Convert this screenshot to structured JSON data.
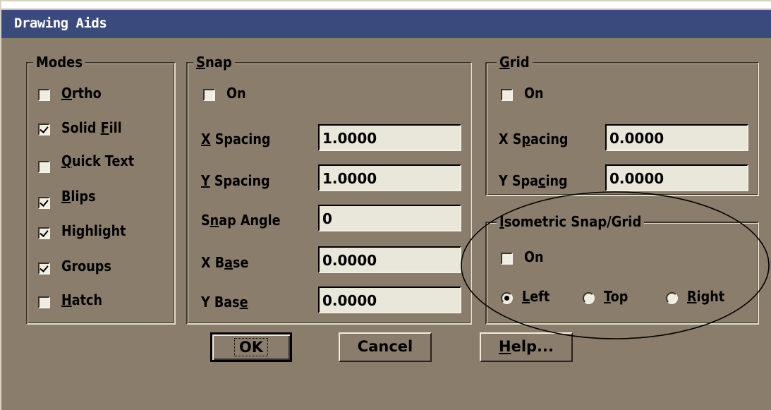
{
  "dialog": {
    "title": "Drawing Aids"
  },
  "modes": {
    "legend": "Modes",
    "items": [
      {
        "pre": "",
        "key": "O",
        "post": "rtho",
        "checked": false
      },
      {
        "pre": "Solid ",
        "key": "F",
        "post": "ill",
        "checked": true
      },
      {
        "pre": "",
        "key": "Q",
        "post": "uick Text",
        "checked": false
      },
      {
        "pre": "",
        "key": "B",
        "post": "lips",
        "checked": true
      },
      {
        "pre": "Hi",
        "key": "g",
        "post": "hlight",
        "checked": true
      },
      {
        "pre": "Groups",
        "key": "",
        "post": "",
        "checked": true
      },
      {
        "pre": "",
        "key": "H",
        "post": "atch",
        "checked": false
      }
    ]
  },
  "snap": {
    "legend_key": "S",
    "legend_rest": "nap",
    "on_label": "On",
    "on_checked": false,
    "fields": [
      {
        "pre": "",
        "key": "X",
        "post": " Spacing",
        "value": "1.0000"
      },
      {
        "pre": "",
        "key": "Y",
        "post": " Spacing",
        "value": "1.0000"
      },
      {
        "pre": "S",
        "key": "n",
        "post": "ap Angle",
        "value": "0"
      },
      {
        "pre": "X B",
        "key": "a",
        "post": "se",
        "value": "0.0000"
      },
      {
        "pre": "Y Bas",
        "key": "e",
        "post": "",
        "value": "0.0000"
      }
    ]
  },
  "grid": {
    "legend_key": "G",
    "legend_rest": "rid",
    "on_label": "On",
    "on_checked": false,
    "fields": [
      {
        "pre": "X S",
        "key": "p",
        "post": "acing",
        "value": "0.0000"
      },
      {
        "pre": "Y Spa",
        "key": "c",
        "post": "ing",
        "value": "0.0000"
      }
    ]
  },
  "iso": {
    "legend_key": "I",
    "legend_rest": "sometric Snap/Grid",
    "on_label": "On",
    "on_checked": false,
    "radios": [
      {
        "key": "L",
        "post": "eft",
        "selected": true
      },
      {
        "key": "T",
        "post": "op",
        "selected": false
      },
      {
        "key": "R",
        "post": "ight",
        "selected": false
      }
    ]
  },
  "buttons": {
    "ok": "OK",
    "cancel": "Cancel",
    "help_key": "H",
    "help_rest": "elp..."
  },
  "colors": {
    "face": "#8b7d6b",
    "title_bar": "#3b4a7c",
    "field_bg": "#e9e6da"
  }
}
